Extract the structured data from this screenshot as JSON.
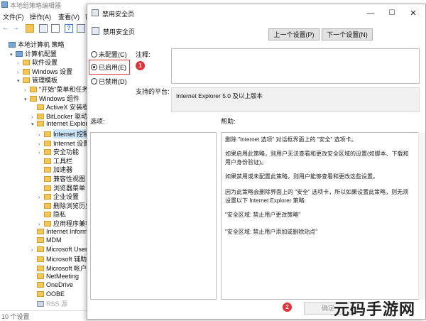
{
  "bg_window": {
    "title": "本地组策略编辑器",
    "menu": [
      "文件(F)",
      "操作(A)",
      "查看(V)",
      "帮"
    ],
    "status": "10 个设置"
  },
  "tree": [
    {
      "label": "本地计算机 策略",
      "indent": 0,
      "expander": "",
      "icon": "pc"
    },
    {
      "label": "计算机配置",
      "indent": 1,
      "expander": "▾",
      "icon": "pc"
    },
    {
      "label": "软件设置",
      "indent": 2,
      "expander": "›",
      "icon": "folder"
    },
    {
      "label": "Windows 设置",
      "indent": 2,
      "expander": "›",
      "icon": "folder"
    },
    {
      "label": "管理模板",
      "indent": 2,
      "expander": "▾",
      "icon": "folder"
    },
    {
      "label": "\"开始\"菜单和任务栏",
      "indent": 3,
      "expander": "›",
      "icon": "folder"
    },
    {
      "label": "Windows 组件",
      "indent": 3,
      "expander": "▾",
      "icon": "folder"
    },
    {
      "label": "ActiveX 安装程序",
      "indent": 4,
      "expander": "",
      "icon": "folder"
    },
    {
      "label": "BitLocker 驱动器",
      "indent": 4,
      "expander": "›",
      "icon": "folder"
    },
    {
      "label": "Internet Explorer",
      "indent": 4,
      "expander": "▾",
      "icon": "folder"
    },
    {
      "label": "Internet 控制",
      "indent": 5,
      "expander": "›",
      "icon": "folder",
      "selected": true
    },
    {
      "label": "Internet 设置",
      "indent": 5,
      "expander": "›",
      "icon": "folder"
    },
    {
      "label": "安全功能",
      "indent": 5,
      "expander": "›",
      "icon": "folder"
    },
    {
      "label": "工具栏",
      "indent": 5,
      "expander": "",
      "icon": "folder"
    },
    {
      "label": "加速器",
      "indent": 5,
      "expander": "",
      "icon": "folder"
    },
    {
      "label": "兼容性视图",
      "indent": 5,
      "expander": "",
      "icon": "folder"
    },
    {
      "label": "浏览器菜单",
      "indent": 5,
      "expander": "",
      "icon": "folder"
    },
    {
      "label": "企业设置",
      "indent": 5,
      "expander": "›",
      "icon": "folder"
    },
    {
      "label": "删除浏览历史",
      "indent": 5,
      "expander": "",
      "icon": "folder"
    },
    {
      "label": "隐私",
      "indent": 5,
      "expander": "",
      "icon": "folder"
    },
    {
      "label": "应用程序兼容",
      "indent": 5,
      "expander": "›",
      "icon": "folder"
    },
    {
      "label": "Internet Information",
      "indent": 4,
      "expander": "",
      "icon": "folder"
    },
    {
      "label": "MDM",
      "indent": 4,
      "expander": "",
      "icon": "folder"
    },
    {
      "label": "Microsoft User",
      "indent": 4,
      "expander": "›",
      "icon": "folder"
    },
    {
      "label": "Microsoft 辅助",
      "indent": 4,
      "expander": "",
      "icon": "folder"
    },
    {
      "label": "Microsoft 帐户",
      "indent": 4,
      "expander": "",
      "icon": "folder"
    },
    {
      "label": "NetMeeting",
      "indent": 4,
      "expander": "",
      "icon": "folder"
    },
    {
      "label": "OneDrive",
      "indent": 4,
      "expander": "",
      "icon": "folder"
    },
    {
      "label": "OOBE",
      "indent": 4,
      "expander": "",
      "icon": "folder"
    },
    {
      "label": "RSS 源",
      "indent": 4,
      "expander": "",
      "icon": "policy",
      "dim": true
    }
  ],
  "dialog": {
    "title": "禁用安全页",
    "heading": "禁用安全页",
    "prev_button": "上一个设置(P)",
    "next_button": "下一个设置(N)",
    "radio_not_configured": "未配置(C)",
    "radio_enabled": "已启用(E)",
    "radio_disabled": "已禁用(D)",
    "selected_option": "enabled",
    "comment_label": "注释:",
    "platform_label": "支持的平台:",
    "platform_value": "Internet Explorer 5.0 及以上版本",
    "options_label": "选项:",
    "help_label": "帮助:",
    "help_paragraphs": [
      "删除 \"Internet 选项\" 对话框界面上的 \"安全\" 选项卡。",
      "如果启用此策略，则用户无法查看和更改安全区域的设置(如脚本、下载和用户身份验证)。",
      "如果禁用或未配置此策略，则用户能够查看和更改这些设置。",
      "因为此策略会删除界面上的 \"安全\" 选项卡，所以如果设置此策略，则无须设置以下 Internet Explorer 策略:",
      "\"安全区域: 禁止用户更改策略\"",
      "\"安全区域: 禁止用户添加或删除站点\""
    ],
    "ok_button": "确定",
    "badge_1": "1",
    "badge_2": "2"
  },
  "watermark": "元码手游网",
  "colors": {
    "accent_red": "#e0343a",
    "folder": "#f2c65a",
    "selection": "#cce4f7"
  }
}
